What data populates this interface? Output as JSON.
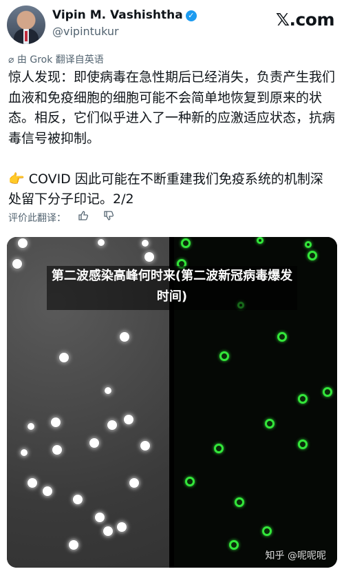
{
  "author": {
    "name": "Vipin M. Vashishtha",
    "handle": "@vipintukur",
    "verified_icon": "verified-badge-icon"
  },
  "brand": {
    "logo": "𝕏.com"
  },
  "translation_note": "由 Grok 翻译自英语",
  "tweet": {
    "paragraph1": "惊人发现：即使病毒在急性期后已经消失，负责产生我们血液和免疫细胞的细胞可能不会简单地恢复到原来的状态。相反，它们似乎进入了一种新的应激适应状态，抗病毒信号被抑制。",
    "paragraph2": "👉 COVID 因此可能在不断重建我们免疫系统的机制深处留下分子印记。2/2"
  },
  "rating": {
    "label": "评价此翻译：",
    "like_icon": "thumbs-up-icon",
    "dislike_icon": "thumbs-down-icon"
  },
  "media": {
    "overlay_title": "第二波感染高峰何时来(第二波新冠病毒爆发时间)",
    "watermark": "知乎 @呢呢呢"
  }
}
